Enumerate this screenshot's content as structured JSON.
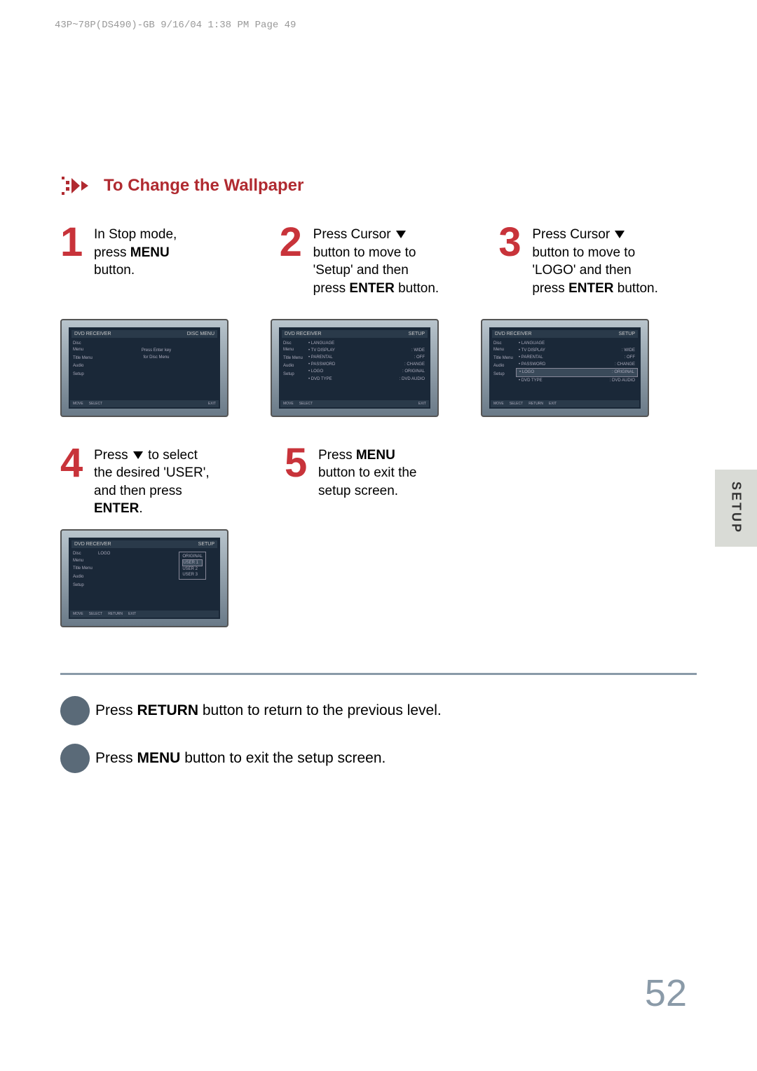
{
  "header": {
    "runningHead": "43P~78P(DS490)-GB  9/16/04 1:38 PM  Page 49"
  },
  "section": {
    "title": "To Change the Wallpaper"
  },
  "steps": {
    "s1": {
      "num": "1",
      "line1": "In Stop mode,",
      "line2_pre": "press ",
      "line2_bold": "MENU",
      "line3": "button."
    },
    "s2": {
      "num": "2",
      "line1": "Press Cursor ",
      "line2": "button to move to",
      "line3": "'Setup' and then",
      "line4_pre": "press ",
      "line4_bold": "ENTER",
      "line4_post": " button."
    },
    "s3": {
      "num": "3",
      "line1": "Press Cursor ",
      "line2": "button to move to",
      "line3": "'LOGO' and then",
      "line4_pre": "press ",
      "line4_bold": "ENTER",
      "line4_post": " button."
    },
    "s4": {
      "num": "4",
      "line1_pre": "Press ",
      "line1_post": " to select",
      "line2": "the desired 'USER',",
      "line3": "and then press",
      "line4_bold": "ENTER",
      "line4_post": "."
    },
    "s5": {
      "num": "5",
      "line1_pre": "Press ",
      "line1_bold": "MENU",
      "line2": "button to exit the",
      "line3": "setup screen."
    }
  },
  "screens": {
    "s1": {
      "headerLeft": "DVD RECEIVER",
      "headerRight": "DISC MENU",
      "sidebar": [
        "Disc Menu",
        "Title Menu",
        "Audio",
        "Setup"
      ],
      "mainLine1": "Press Enter key",
      "mainLine2": "for Disc Menu",
      "footer": [
        "MOVE",
        "SELECT",
        "EXIT"
      ]
    },
    "s2": {
      "headerLeft": "DVD RECEIVER",
      "headerRight": "SETUP",
      "sidebar": [
        "Disc Menu",
        "Title Menu",
        "Audio",
        "Setup"
      ],
      "rows": [
        {
          "k": "LANGUAGE",
          "v": ""
        },
        {
          "k": "TV DISPLAY",
          "v": ": WIDE"
        },
        {
          "k": "PARENTAL",
          "v": ": OFF"
        },
        {
          "k": "PASSWORD",
          "v": ": CHANGE"
        },
        {
          "k": "LOGO",
          "v": ": ORIGINAL"
        },
        {
          "k": "DVD TYPE",
          "v": ": DVD AUDIO"
        }
      ],
      "footer": [
        "MOVE",
        "SELECT",
        "EXIT"
      ]
    },
    "s3": {
      "headerLeft": "DVD RECEIVER",
      "headerRight": "SETUP",
      "sidebar": [
        "Disc Menu",
        "Title Menu",
        "Audio",
        "Setup"
      ],
      "rows": [
        {
          "k": "LANGUAGE",
          "v": ""
        },
        {
          "k": "TV DISPLAY",
          "v": ": WIDE"
        },
        {
          "k": "PARENTAL",
          "v": ": OFF"
        },
        {
          "k": "PASSWORD",
          "v": ": CHANGE"
        },
        {
          "k": "LOGO",
          "v": ": ORIGINAL",
          "hl": true
        },
        {
          "k": "DVD TYPE",
          "v": ": DVD AUDIO"
        }
      ],
      "footer": [
        "MOVE",
        "SELECT",
        "RETURN",
        "EXIT"
      ]
    },
    "s4": {
      "headerLeft": "DVD RECEIVER",
      "headerRight": "SETUP",
      "sidebar": [
        "Disc Menu",
        "Title Menu",
        "Audio",
        "Setup"
      ],
      "mainKey": "LOGO",
      "submenu": [
        "ORIGINAL",
        "USER 1",
        "USER 2",
        "USER 3"
      ],
      "submenuHl": 1,
      "footer": [
        "MOVE",
        "SELECT",
        "RETURN",
        "EXIT"
      ]
    }
  },
  "sideTab": "SETUP",
  "notes": {
    "n1_pre": "Press ",
    "n1_bold": "RETURN",
    "n1_post": " button to return to the previous level.",
    "n2_pre": "Press ",
    "n2_bold": "MENU",
    "n2_post": " button to exit the setup screen."
  },
  "pageNumber": "52"
}
